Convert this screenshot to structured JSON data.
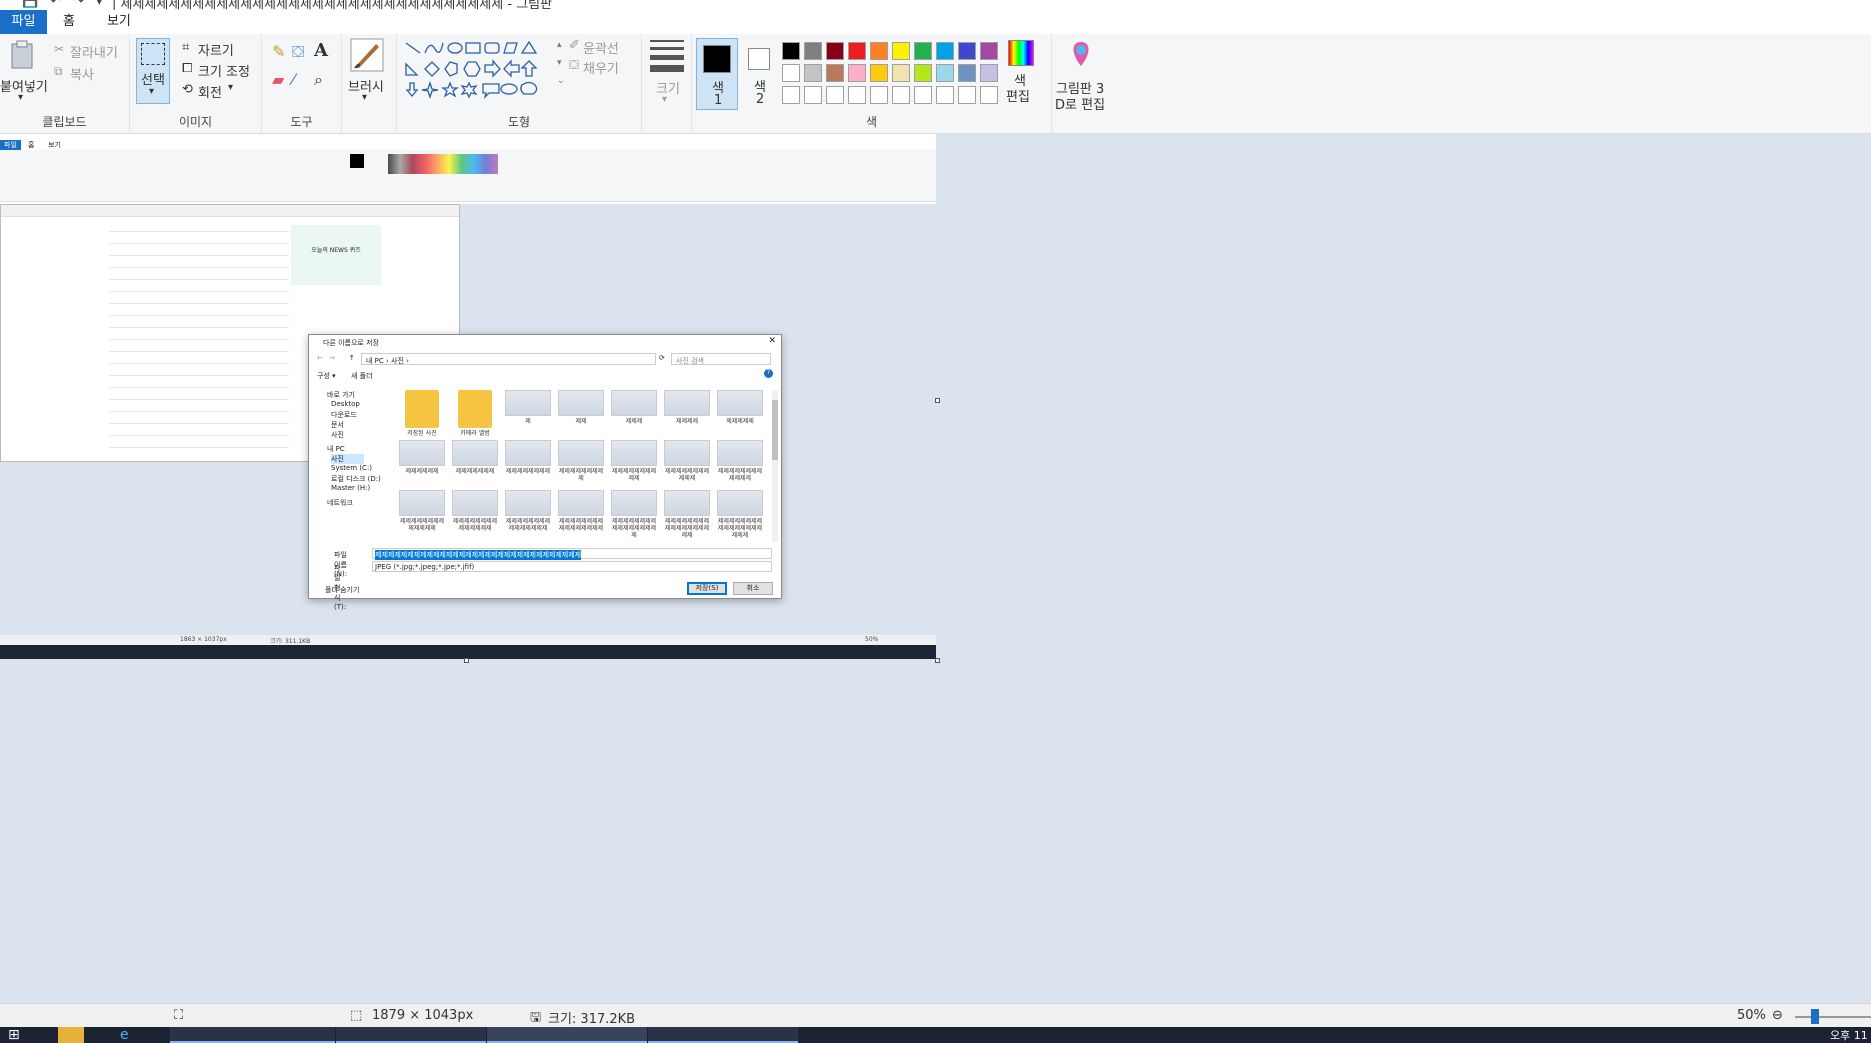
{
  "titlebar": {
    "quick_access": [
      "💾",
      "↶",
      "↷",
      "▾"
    ],
    "title": "| 제제제제제제제제제제제제제제제제제제제제제제제제제제제제제제제제 - 그림판"
  },
  "tabs": {
    "file": "파일",
    "home": "홈",
    "view": "보기"
  },
  "ribbon": {
    "clipboard": {
      "paste": "붙여넣기",
      "cut": "잘라내기",
      "copy": "복사",
      "label": "클립보드"
    },
    "image": {
      "select": "선택",
      "crop": "자르기",
      "resize": "크기 조정",
      "rotate": "회전",
      "label": "이미지"
    },
    "tools": {
      "label": "도구"
    },
    "brush": {
      "label": "브러시"
    },
    "shapes": {
      "outline": "윤곽선",
      "fill": "채우기",
      "label": "도형"
    },
    "size": {
      "label": "크기"
    },
    "colors": {
      "color1": "색\n1",
      "color1_a": "색",
      "color1_b": "1",
      "color2_a": "색",
      "color2_b": "2",
      "edit_a": "색",
      "edit_b": "편집",
      "label": "색",
      "palette_row1": [
        "#000000",
        "#7f7f7f",
        "#880015",
        "#ed1c24",
        "#ff7f27",
        "#fff200",
        "#22b14c",
        "#00a2e8",
        "#3f48cc",
        "#a349a4"
      ],
      "palette_row2": [
        "#ffffff",
        "#c3c3c3",
        "#b97a57",
        "#ffaec9",
        "#ffc90e",
        "#efe4b0",
        "#b5e61d",
        "#99d9ea",
        "#7092be",
        "#c8bfe7"
      ]
    },
    "paint3d": {
      "line1": "그림판 3",
      "line2": "D로 편집"
    }
  },
  "dialog": {
    "title": "다른 이름으로 저장",
    "address": "내 PC  ›  사진  ›",
    "search_placeholder": "사진 검색",
    "organize": "구성 ▾",
    "new_folder": "새 폴더",
    "nav": [
      "바로 가기",
      "Desktop",
      "다운로드",
      "문서",
      "사진",
      "내 PC",
      "사진",
      "System (C:)",
      "로컬 디스크 (D:)",
      "Master (H:)",
      "네트워크"
    ],
    "thumbs": [
      "저장된 사진",
      "카메라 앨범",
      "제",
      "제제",
      "제제제",
      "제제제제",
      "제제제제제",
      "제제제제제제",
      "제제제제제제제",
      "제제제제제제제제",
      "제제제제제제제제제",
      "제제제제제제제제제제",
      "제제제제제제제제제제제",
      "제제제제제제제제제제제제",
      "제제제제제제제제제제제제제",
      "제제제제제제제제제제제제제제",
      "제제제제제제제제제제제제제제제",
      "제제제제제제제제제제제제제제제제",
      "제제제제제제제제제제제제제제제제제",
      "제제제제제제제제제제제제제제제제제제",
      "제제제제제제제제제제제제제제제제제제제"
    ],
    "filename_label": "파일 이름(N):",
    "filename_value": "제제제제제제제제제제제제제제제제제제제제제제제제제제제제제제제제",
    "filetype_label": "파일 형식(T):",
    "filetype_value": "JPEG (*.jpg;*.jpeg;*.jpe;*.jfif)",
    "hide_folders": "폴더 숨기기",
    "save": "저장(S)",
    "cancel": "취소"
  },
  "mini": {
    "tabs": [
      "파일",
      "홈",
      "보기"
    ],
    "status_dims": "1863 × 1037px",
    "status_size": "크기: 311.1KB",
    "zoom": "50%",
    "news_title": "오늘의 NEWS 퀴즈"
  },
  "status": {
    "dimensions": "1879 × 1043px",
    "size": "크기: 317.2KB",
    "zoom": "50%"
  },
  "clock": "오후 11"
}
